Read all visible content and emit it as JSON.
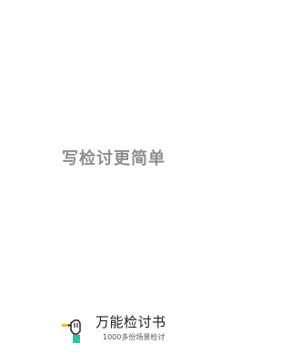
{
  "splash": {
    "slogan": "写检讨更简单"
  },
  "brand": {
    "app_name": "万能检讨书",
    "tagline": "1000多份场景检讨",
    "logo_icon": "hand-pen-logo-icon",
    "accent_color": "#2ec4a0",
    "ink_color": "#222222",
    "pencil_color": "#f2b830"
  }
}
